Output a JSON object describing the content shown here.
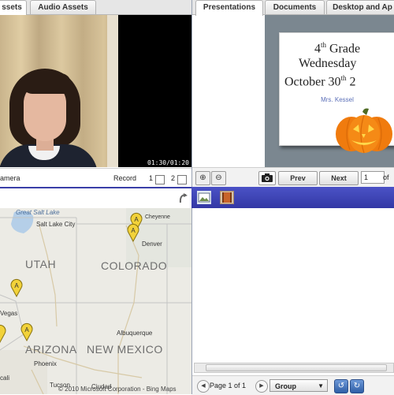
{
  "video_panel": {
    "tabs": [
      {
        "label": "ssets"
      },
      {
        "label": "Audio Assets"
      }
    ],
    "timecode": "01:30/01:20",
    "camera_label": "amera",
    "record_label": "Record",
    "record_options": [
      "1",
      "2"
    ]
  },
  "presentations_panel": {
    "tabs": [
      {
        "label": "Presentations"
      },
      {
        "label": "Documents"
      },
      {
        "label": "Desktop and Ap"
      }
    ],
    "slide": {
      "line1": "4th Grade",
      "line2": "Wednesday",
      "line3": "October 30th 2",
      "author": "Mrs. Kessel"
    },
    "controls": {
      "prev_label": "Prev",
      "next_label": "Next",
      "page_value": "1",
      "of_label": "of"
    }
  },
  "map": {
    "state_labels": [
      "UTAH",
      "COLORADO",
      "ARIZONA",
      "NEW MEXICO"
    ],
    "cities": [
      "Great Salt Lake",
      "Salt Lake City",
      "Cheyenne",
      "Denver",
      "Vegas",
      "Albuquerque",
      "Phoenix",
      "Tucson",
      "Ciudad",
      "cali"
    ],
    "pin_letter": "A",
    "credit": "© 2010 Microsoft Corporation - Bing Maps",
    "colors": {
      "land": "#ecebe5",
      "water": "#b5cfe8",
      "pin": "#f2d23a"
    }
  },
  "grid_controls": {
    "page_text": "Page 1 of 1",
    "group_value": "Group"
  },
  "colors": {
    "strip_blue": "#3f45b8",
    "slide_bg": "#7b8790"
  }
}
